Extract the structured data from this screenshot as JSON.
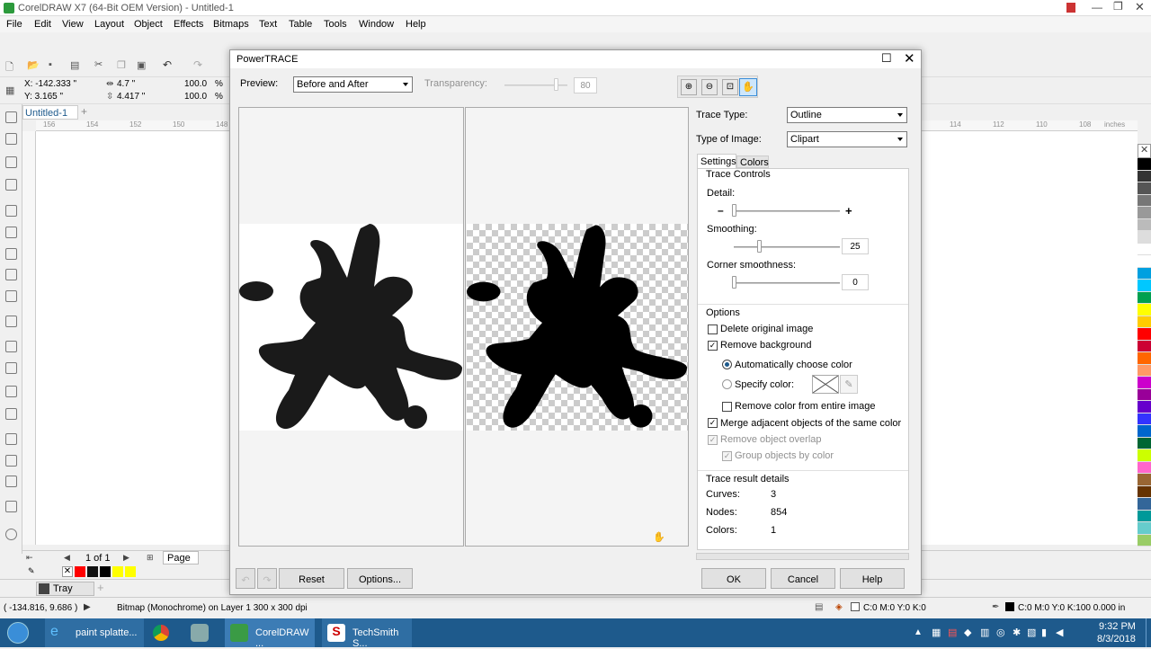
{
  "app": {
    "title": "CorelDRAW X7 (64-Bit OEM Version) - Untitled-1"
  },
  "menu": [
    "File",
    "Edit",
    "View",
    "Layout",
    "Object",
    "Effects",
    "Bitmaps",
    "Text",
    "Table",
    "Tools",
    "Window",
    "Help"
  ],
  "propbar": {
    "x": "X: -142.333 \"",
    "y": "Y: 3.165 \"",
    "w": "4.7 \"",
    "h": "4.417 \"",
    "sx": "100.0",
    "sy": "100.0",
    "pct": "%"
  },
  "doc_tab": "Untitled-1",
  "ruler_left": [
    "156",
    "154",
    "152",
    "150",
    "148"
  ],
  "ruler_right": [
    "114",
    "112",
    "110",
    "108"
  ],
  "ruler_unit": "inches",
  "page_nav": {
    "count": "1 of 1",
    "page": "Page 1"
  },
  "tray": "Tray",
  "status": {
    "coords": "( -134.816, 9.686 )",
    "info": "Bitmap (Monochrome) on Layer 1 300 x 300 dpi",
    "fill": "C:0 M:0 Y:0 K:0",
    "outline": "C:0 M:0 Y:0 K:100  0.000 in"
  },
  "dialog": {
    "title": "PowerTRACE",
    "preview_label": "Preview:",
    "preview_value": "Before and After",
    "transparency_label": "Transparency:",
    "transparency_value": "80",
    "trace_type_label": "Trace Type:",
    "trace_type_value": "Outline",
    "image_type_label": "Type of Image:",
    "image_type_value": "Clipart",
    "tabs": [
      "Settings",
      "Colors"
    ],
    "trace_controls": "Trace Controls",
    "detail_label": "Detail:",
    "detail_level": 0.0,
    "smoothing_label": "Smoothing:",
    "smoothing_value": "25",
    "corner_label": "Corner smoothness:",
    "corner_value": "0",
    "options_label": "Options",
    "options": {
      "delete_original": "Delete original image",
      "remove_background": "Remove background",
      "auto_color": "Automatically choose color",
      "specify_color": "Specify color:",
      "remove_entire": "Remove color from entire image",
      "merge_adjacent": "Merge adjacent objects of the same color",
      "remove_overlap": "Remove object overlap",
      "group_by_color": "Group objects by color"
    },
    "result_label": "Trace result details",
    "results": {
      "curves_label": "Curves:",
      "curves": "3",
      "nodes_label": "Nodes:",
      "nodes": "854",
      "colors_label": "Colors:",
      "colors": "1"
    },
    "buttons": {
      "reset": "Reset",
      "options": "Options...",
      "ok": "OK",
      "cancel": "Cancel",
      "help": "Help"
    }
  },
  "taskbar": {
    "items": [
      "paint splatte...",
      "CorelDRAW ...",
      "TechSmith S..."
    ],
    "time": "9:32 PM",
    "date": "8/3/2018"
  },
  "colors": {
    "accent": "#1e5a8c",
    "selected_palette": "#ff0000"
  },
  "palette": [
    "#000000",
    "#333333",
    "#555555",
    "#777777",
    "#999999",
    "#bbbbbb",
    "#dddddd",
    "#ffffff",
    "#ffffff",
    "#00a0e0",
    "#00c8ff",
    "#00a050",
    "#ffff00",
    "#ffcc00",
    "#ff0000",
    "#cc0033",
    "#ff6600",
    "#ff9966",
    "#cc00cc",
    "#990099",
    "#6600cc",
    "#3333ff",
    "#0066cc",
    "#006633",
    "#ccff00",
    "#ff66cc",
    "#996633",
    "#663300",
    "#336699",
    "#009999",
    "#66cccc",
    "#99cc66",
    "#ffcc99"
  ]
}
